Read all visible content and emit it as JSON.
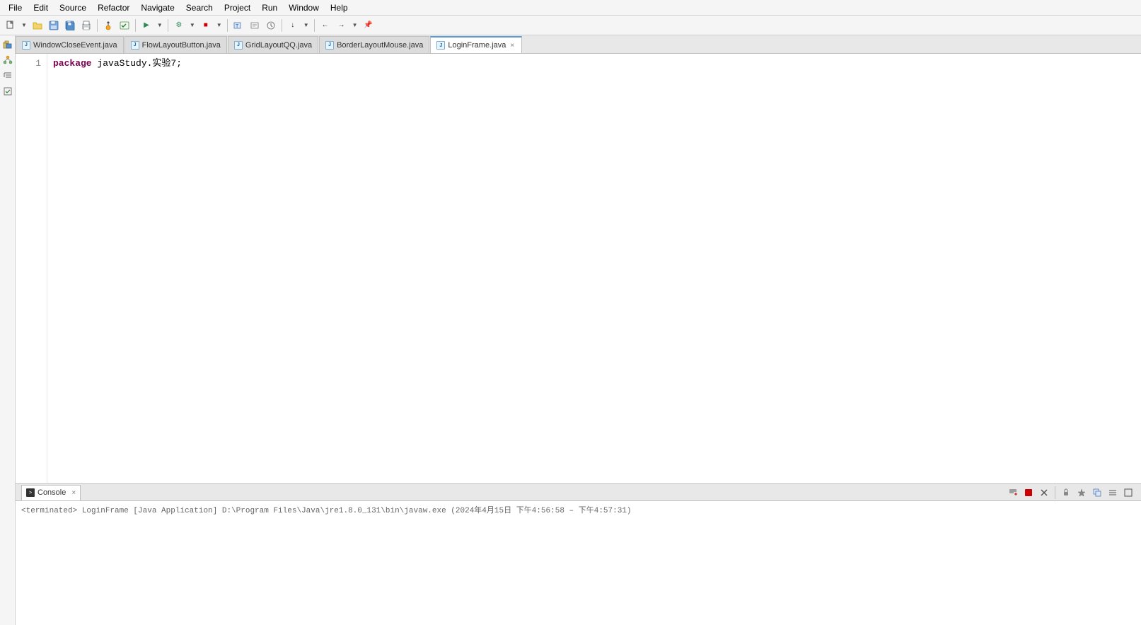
{
  "menu": {
    "items": [
      "File",
      "Edit",
      "Source",
      "Refactor",
      "Navigate",
      "Search",
      "Project",
      "Run",
      "Window",
      "Help"
    ]
  },
  "tabs": [
    {
      "label": "WindowCloseEvent.java",
      "active": false,
      "closable": false
    },
    {
      "label": "FlowLayoutButton.java",
      "active": false,
      "closable": false
    },
    {
      "label": "GridLayoutQQ.java",
      "active": false,
      "closable": false
    },
    {
      "label": "BorderLayoutMouse.java",
      "active": false,
      "closable": false
    },
    {
      "label": "LoginFrame.java",
      "active": true,
      "closable": true
    }
  ],
  "editor": {
    "lines": [
      {
        "number": "1",
        "content": "package javaStudy.实验7;"
      }
    ]
  },
  "console": {
    "title": "Console",
    "close_icon": "×",
    "terminated_text": "<terminated> LoginFrame [Java Application] D:\\Program Files\\Java\\jre1.8.0_131\\bin\\javaw.exe  (2024年4月15日 下午4:56:58 – 下午4:57:31)"
  }
}
